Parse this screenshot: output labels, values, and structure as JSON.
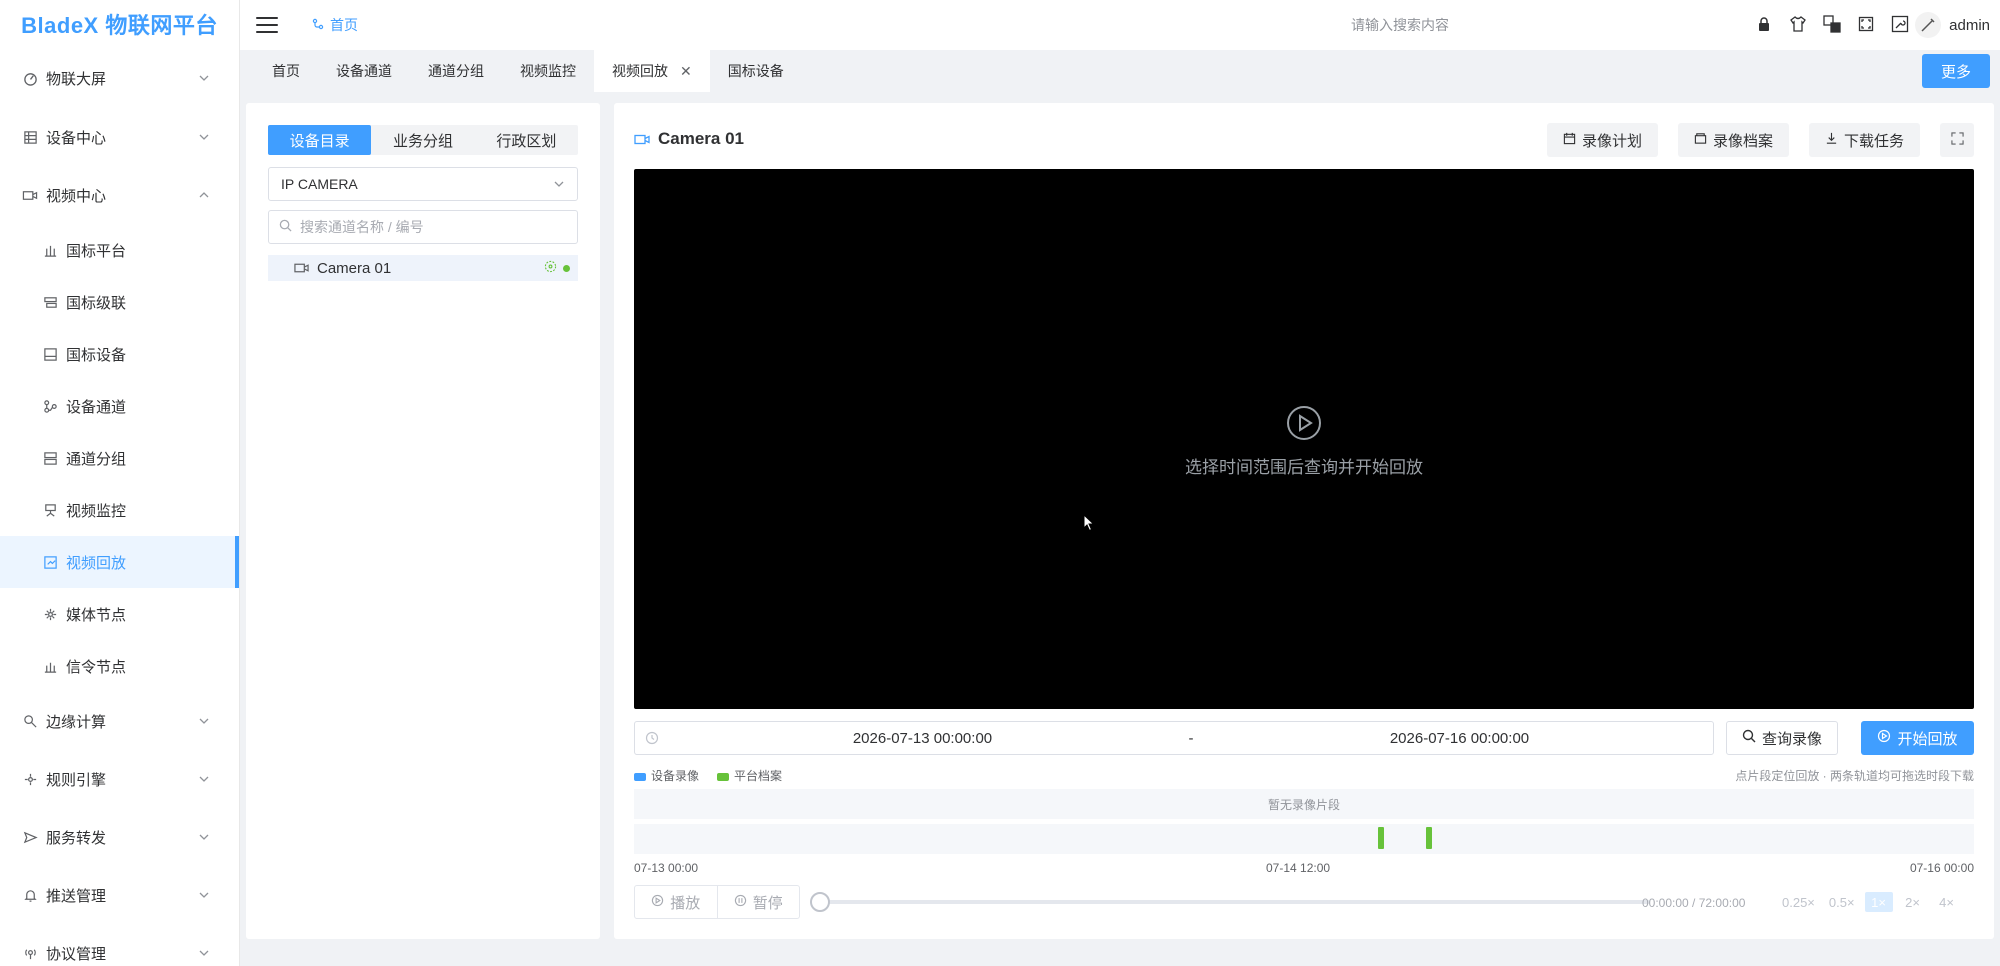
{
  "app": {
    "logo": "BladeX 物联网平台"
  },
  "topbar": {
    "breadcrumb": "首页",
    "search_placeholder": "请输入搜索内容",
    "user": "admin"
  },
  "sidebar": {
    "groups": [
      {
        "label": "物联大屏",
        "icon": "dashboard-icon"
      },
      {
        "label": "设备中心",
        "icon": "grid-icon"
      },
      {
        "label": "视频中心",
        "icon": "video-icon"
      }
    ],
    "video_children": [
      {
        "label": "国标平台",
        "icon": "platform-icon"
      },
      {
        "label": "国标级联",
        "icon": "cascade-icon"
      },
      {
        "label": "国标设备",
        "icon": "device-icon"
      },
      {
        "label": "设备通道",
        "icon": "channel-icon"
      },
      {
        "label": "通道分组",
        "icon": "group-icon"
      },
      {
        "label": "视频监控",
        "icon": "monitor-icon"
      },
      {
        "label": "视频回放",
        "icon": "playback-icon"
      },
      {
        "label": "媒体节点",
        "icon": "media-node-icon"
      },
      {
        "label": "信令节点",
        "icon": "signal-node-icon"
      }
    ],
    "more_groups": [
      {
        "label": "边缘计算",
        "icon": "edge-icon"
      },
      {
        "label": "规则引擎",
        "icon": "rule-icon"
      },
      {
        "label": "服务转发",
        "icon": "forward-icon"
      },
      {
        "label": "推送管理",
        "icon": "bell-icon"
      },
      {
        "label": "协议管理",
        "icon": "protocol-icon"
      }
    ]
  },
  "tabs": [
    "首页",
    "设备通道",
    "通道分组",
    "视频监控",
    "视频回放",
    "国标设备"
  ],
  "active_tab": "视频回放",
  "tabs_more": "更多",
  "left_panel": {
    "segments": [
      "设备目录",
      "业务分组",
      "行政区划"
    ],
    "select_value": "IP CAMERA",
    "search_placeholder": "搜索通道名称 / 编号",
    "tree_node": "Camera 01"
  },
  "right_panel": {
    "title": "Camera 01",
    "actions": [
      "录像计划",
      "录像档案",
      "下载任务"
    ],
    "player_hint": "选择时间范围后查询并开始回放",
    "range_start": "2026-07-13 00:00:00",
    "range_sep": "-",
    "range_end": "2026-07-16 00:00:00",
    "query_label": "查询录像",
    "play_label": "开始回放",
    "legend": [
      {
        "label": "设备录像",
        "color": "#409eff"
      },
      {
        "label": "平台档案",
        "color": "#67c23a"
      }
    ],
    "legend_hint": "点片段定位回放 · 两条轨道均可拖选时段下载",
    "track1_empty": "暂无录像片段",
    "axis": [
      "07-13 00:00",
      "07-14 12:00",
      "07-16 00:00"
    ],
    "play_btn": "播放",
    "pause_btn": "暂停",
    "timecode": "00:00:00 / 72:00:00",
    "speeds": [
      "0.25×",
      "0.5×",
      "1×",
      "2×",
      "4×"
    ],
    "active_speed": "1×",
    "colors": {
      "accent": "#409eff",
      "ok": "#67c23a"
    }
  }
}
